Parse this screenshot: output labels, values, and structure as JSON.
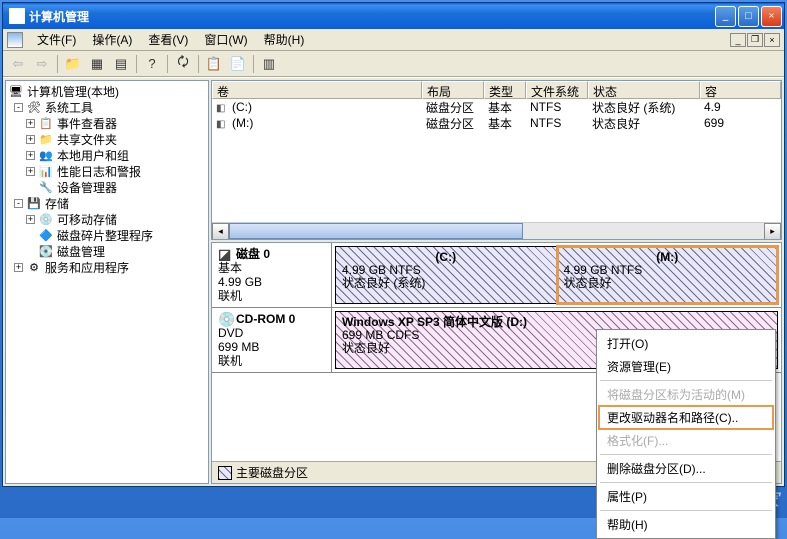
{
  "window": {
    "title": "计算机管理"
  },
  "menu": {
    "file": "文件(F)",
    "action": "操作(A)",
    "view": "查看(V)",
    "window": "窗口(W)",
    "help": "帮助(H)"
  },
  "tree": {
    "root": "计算机管理(本地)",
    "system_tools": "系统工具",
    "event_viewer": "事件查看器",
    "shared_folders": "共享文件夹",
    "local_users": "本地用户和组",
    "perf_logs": "性能日志和警报",
    "device_mgr": "设备管理器",
    "storage": "存储",
    "removable": "可移动存储",
    "defrag": "磁盘碎片整理程序",
    "disk_mgmt": "磁盘管理",
    "services": "服务和应用程序"
  },
  "columns": {
    "volume": "卷",
    "layout": "布局",
    "type": "类型",
    "fs": "文件系统",
    "status": "状态",
    "capacity": "容"
  },
  "volumes": [
    {
      "name": "(C:)",
      "layout": "磁盘分区",
      "type": "基本",
      "fs": "NTFS",
      "status": "状态良好 (系统)",
      "cap": "4.9"
    },
    {
      "name": "(M:)",
      "layout": "磁盘分区",
      "type": "基本",
      "fs": "NTFS",
      "status": "状态良好",
      "cap": "699"
    }
  ],
  "disks": {
    "d0_title": "磁盘 0",
    "d0_type": "基本",
    "d0_size": "4.99 GB",
    "d0_status": "联机",
    "p0_name": "(C:)",
    "p0_size": "4.99 GB NTFS",
    "p0_status": "状态良好 (系统)",
    "p1_name": "(M:)",
    "p1_size": "4.99 GB NTFS",
    "p1_status": "状态良好",
    "cd_title": "CD-ROM 0",
    "cd_type": "DVD",
    "cd_size": "699 MB",
    "cd_status": "联机",
    "cd_p_name": "Windows XP SP3 简体中文版  (D:)",
    "cd_p_size": "699 MB CDFS",
    "cd_p_status": "状态良好"
  },
  "legend": {
    "primary": "主要磁盘分区"
  },
  "context": {
    "open": "打开(O)",
    "explore": "资源管理(E)",
    "mark_active": "将磁盘分区标为活动的(M)",
    "change_letter": "更改驱动器名和路径(C)..",
    "format": "格式化(F)...",
    "delete": "删除磁盘分区(D)...",
    "properties": "属性(P)",
    "help": "帮助(H)"
  },
  "watermark": "系统之家"
}
